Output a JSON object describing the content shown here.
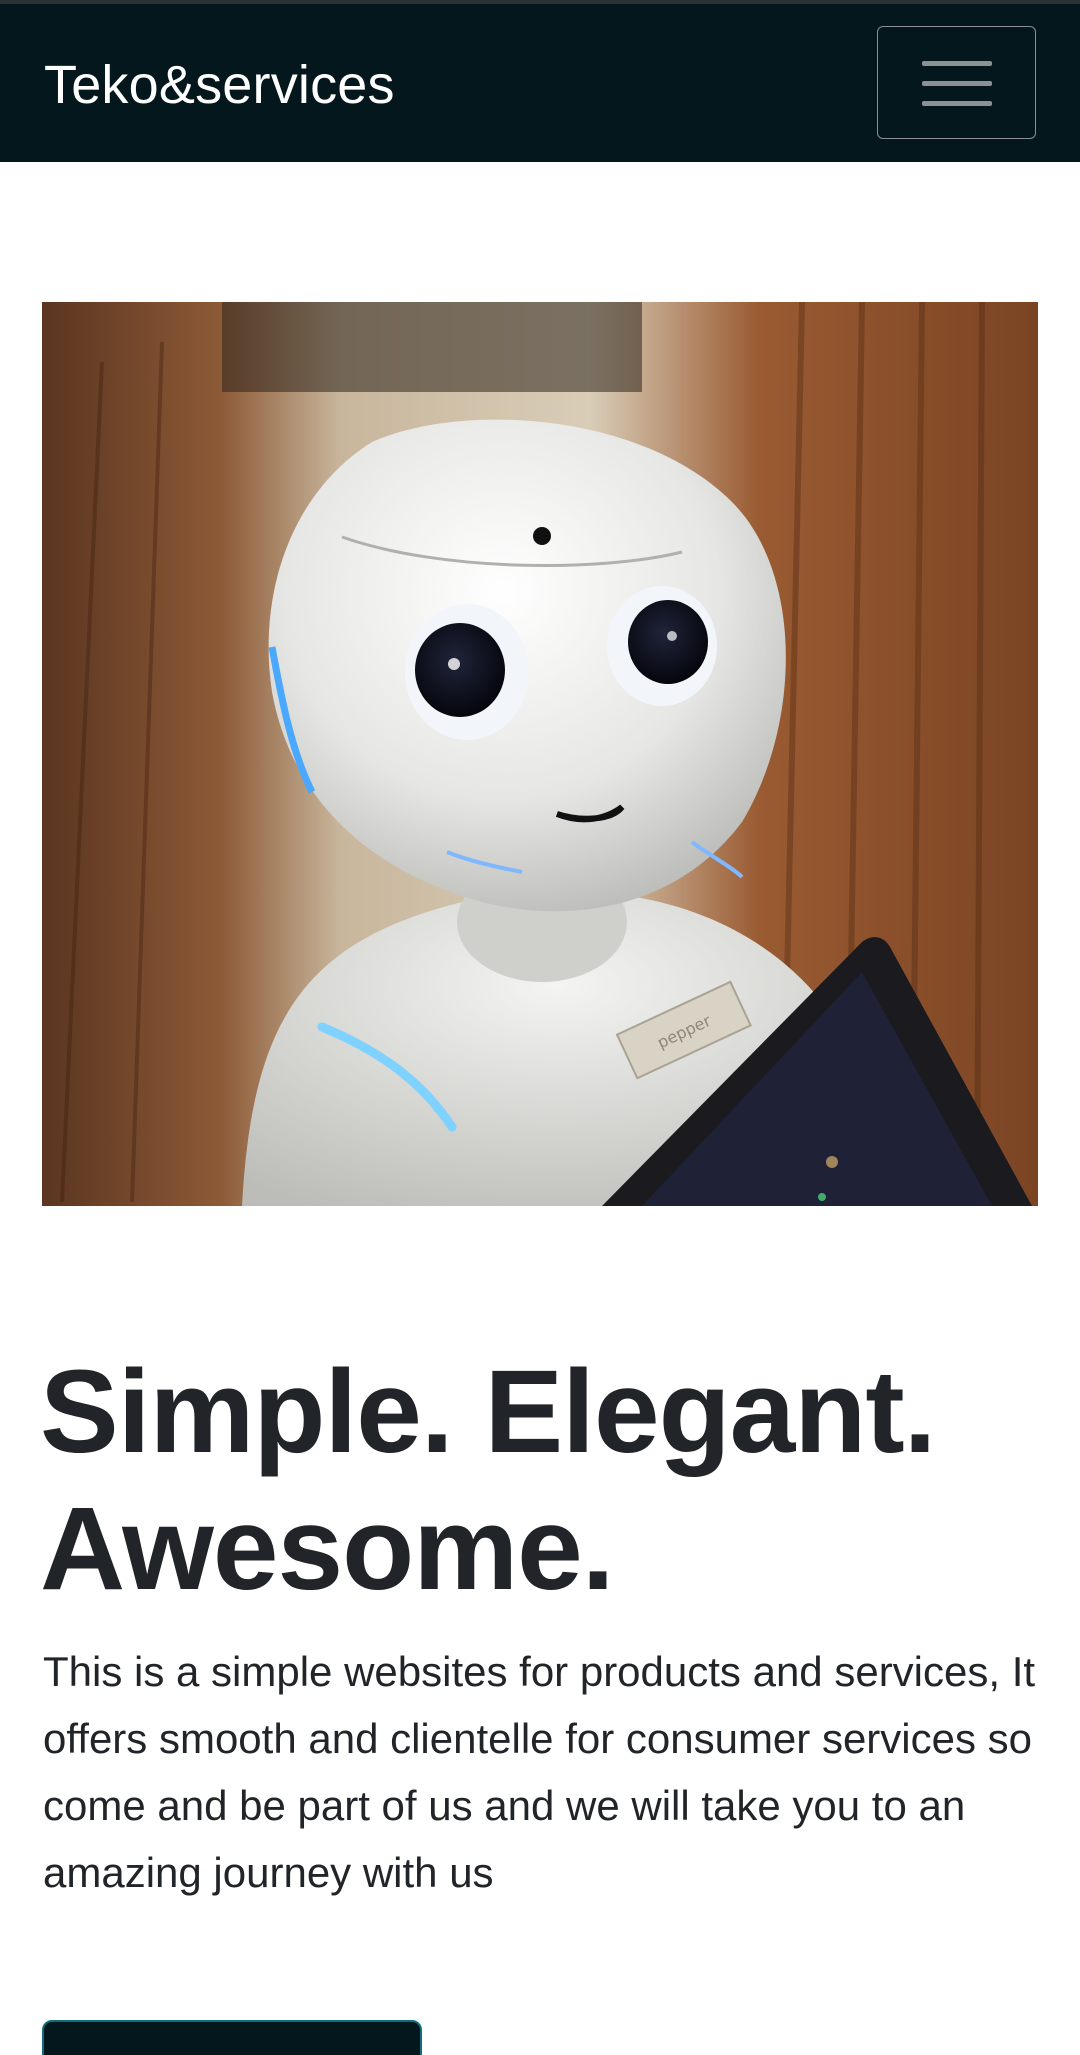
{
  "navbar": {
    "brand": "Teko&services",
    "toggler_icon": "hamburger-menu-icon"
  },
  "hero": {
    "image_description": "robot-photo",
    "image_tag_text": "pepper",
    "headline_line1": "Simple. Elegant.",
    "headline_line2": "Awesome.",
    "lead": "This is a simple websites for products and services, It offers smooth and clientelle for consumer services so come and be part of us and we will take you to an amazing journey with us",
    "cta_label": ""
  },
  "colors": {
    "navbar_bg": "#03171d",
    "text": "#212529",
    "cta_bg": "#03171d",
    "cta_border": "#0d6e7a"
  }
}
